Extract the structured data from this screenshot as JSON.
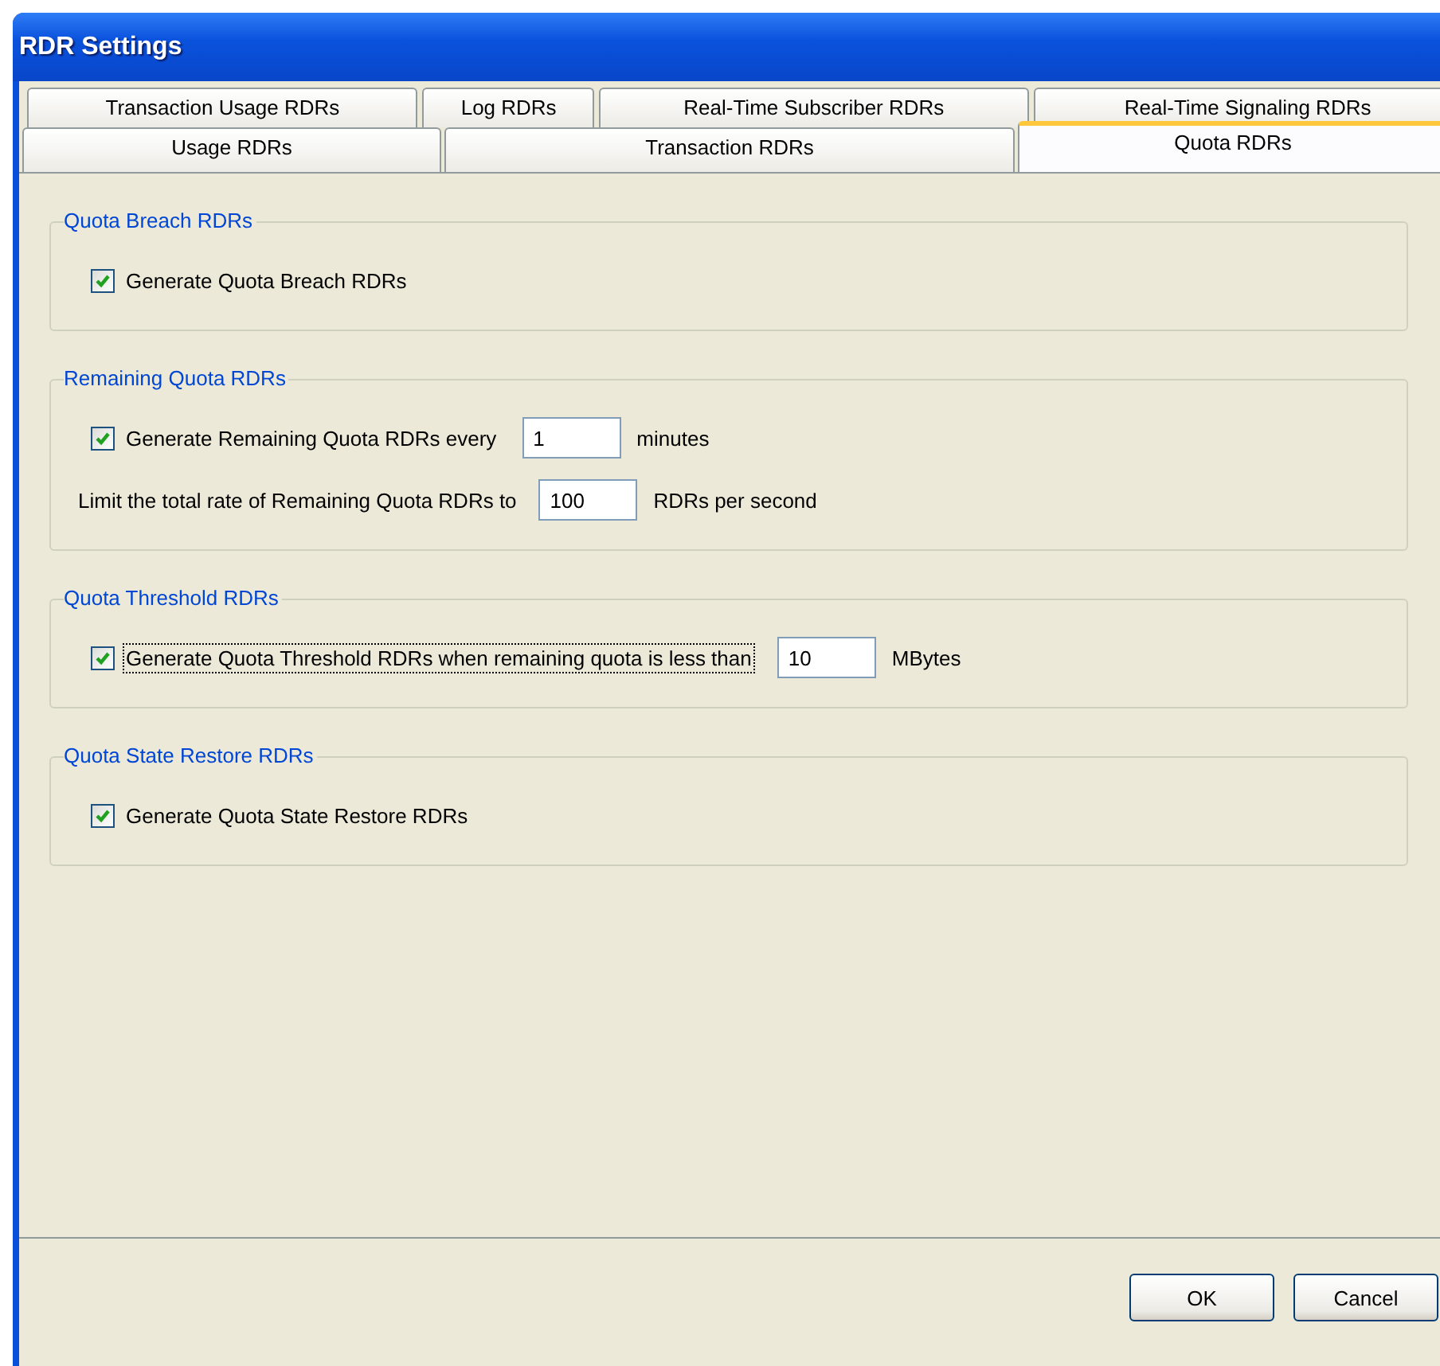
{
  "window": {
    "title": "RDR Settings"
  },
  "tab_rows": [
    {
      "tabs": [
        {
          "label": "Transaction Usage RDRs",
          "selected": false
        },
        {
          "label": "Log RDRs",
          "selected": false
        },
        {
          "label": "Real-Time Subscriber RDRs",
          "selected": false
        },
        {
          "label": "Real-Time Signaling RDRs",
          "selected": false
        }
      ]
    },
    {
      "tabs": [
        {
          "label": "Usage RDRs",
          "selected": false
        },
        {
          "label": "Transaction RDRs",
          "selected": false
        },
        {
          "label": "Quota RDRs",
          "selected": true
        }
      ]
    }
  ],
  "groups": [
    {
      "title": "Quota Breach RDRs",
      "rows": [
        [
          {
            "kind": "checkbox",
            "label": "Generate Quota Breach RDRs",
            "checked": true,
            "focused": false
          }
        ]
      ]
    },
    {
      "title": "Remaining Quota RDRs",
      "rows": [
        [
          {
            "kind": "checkbox",
            "label": "Generate Remaining Quota RDRs every",
            "checked": true,
            "focused": false
          },
          {
            "kind": "field",
            "value": "1"
          },
          {
            "kind": "text",
            "text": "minutes"
          }
        ],
        [
          {
            "kind": "text",
            "text": "Limit the total rate of Remaining Quota RDRs to"
          },
          {
            "kind": "field",
            "value": "100"
          },
          {
            "kind": "text",
            "text": "RDRs per second"
          }
        ]
      ]
    },
    {
      "title": "Quota Threshold RDRs",
      "rows": [
        [
          {
            "kind": "checkbox",
            "label": "Generate Quota Threshold RDRs when remaining quota is less than",
            "checked": true,
            "focused": true
          },
          {
            "kind": "field",
            "value": "10"
          },
          {
            "kind": "text",
            "text": "MBytes"
          }
        ]
      ]
    },
    {
      "title": "Quota State Restore RDRs",
      "rows": [
        [
          {
            "kind": "checkbox",
            "label": "Generate Quota State Restore RDRs",
            "checked": true,
            "focused": false
          }
        ]
      ]
    }
  ],
  "buttons": [
    {
      "label": "OK"
    },
    {
      "label": "Cancel"
    }
  ]
}
